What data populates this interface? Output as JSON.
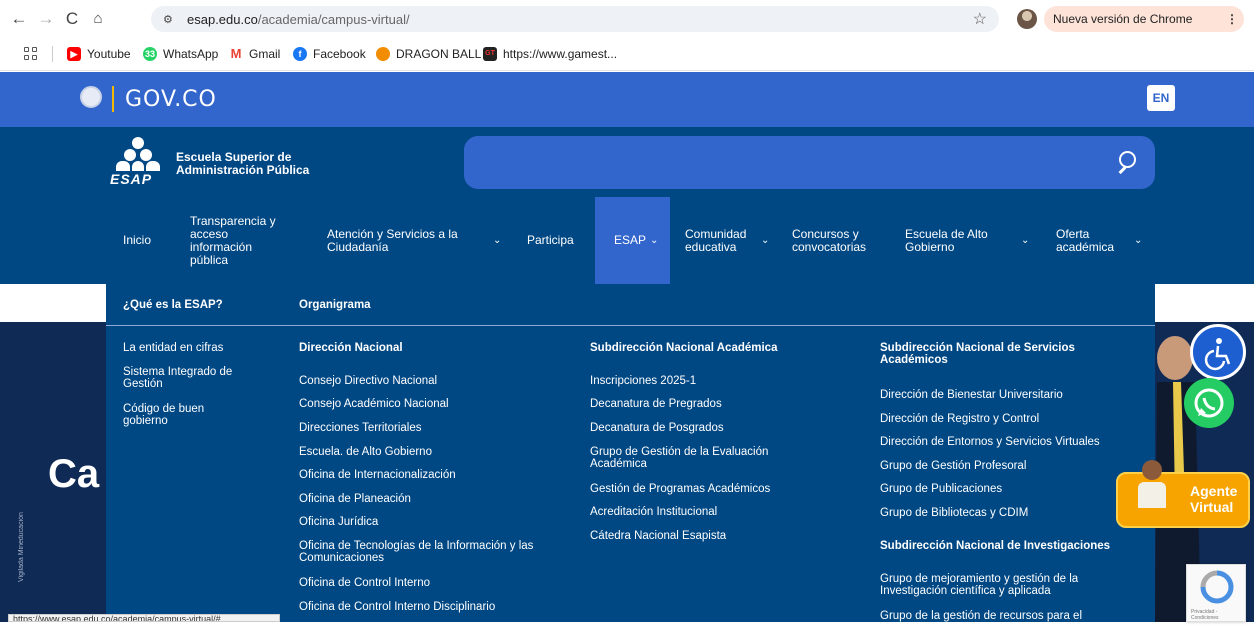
{
  "browser": {
    "url_host": "esap.edu.co",
    "url_path": "/academia/campus-virtual/",
    "update_label": "Nueva versión de Chrome disponible",
    "status_url": "https://www.esap.edu.co/academia/campus-virtual/#"
  },
  "bookmarks": [
    {
      "label": "Youtube",
      "icon": "youtube-icon",
      "color": "#ff0000"
    },
    {
      "label": "WhatsApp",
      "icon": "whatsapp-icon",
      "color": "#25d366"
    },
    {
      "label": "Gmail",
      "icon": "gmail-icon",
      "color": "#ea4335"
    },
    {
      "label": "Facebook",
      "icon": "facebook-icon",
      "color": "#1877f2"
    },
    {
      "label": "DRAGON BALL",
      "icon": "dragon-ball-icon",
      "color": "#f28c00"
    },
    {
      "label": "https://www.gamest...",
      "icon": "gamest-icon",
      "color": "#222222"
    }
  ],
  "gov": {
    "title": "GOV.CO",
    "lang": "EN"
  },
  "esap": {
    "logo_text": "ESAP",
    "name_line1": "Escuela Superior de",
    "name_line2": "Administración Pública"
  },
  "nav": [
    {
      "label": "Inicio"
    },
    {
      "label": "Transparencia y acceso información pública"
    },
    {
      "label": "Atención y Servicios a la Ciudadanía"
    },
    {
      "label": "Participa"
    },
    {
      "label": "ESAP"
    },
    {
      "label": "Comunidad educativa"
    },
    {
      "label": "Concursos y convocatorias"
    },
    {
      "label": "Escuela de Alto Gobierno"
    },
    {
      "label": "Oferta académica"
    }
  ],
  "mega": {
    "top_links": [
      "¿Qué es la ESAP?",
      "Organigrama"
    ],
    "col1": [
      "La entidad en cifras",
      "Sistema Integrado de Gestión",
      "Código de buen gobierno"
    ],
    "col2_head": "Dirección Nacional",
    "col2": [
      "Consejo Directivo Nacional",
      "Consejo Académico Nacional",
      "Direcciones Territoriales",
      "Escuela. de Alto Gobierno",
      "Oficina de Internacionalización",
      "Oficina de Planeación",
      "Oficina Jurídica",
      "Oficina de Tecnologías de la Información y las Comunicaciones",
      "Oficina de Control Interno",
      "Oficina de Control Interno Disciplinario"
    ],
    "col3_head": "Subdirección Nacional Académica",
    "col3": [
      "Inscripciones 2025-1",
      "Decanatura de Pregrados",
      "Decanatura de Posgrados",
      "Grupo de Gestión de la Evaluación Académica",
      "Gestión de Programas Académicos",
      "Acreditación Institucional",
      "Cátedra Nacional Esapista"
    ],
    "col4_head": "Subdirección Nacional de Servicios Académicos",
    "col4": [
      "Dirección de Bienestar Universitario",
      "Dirección de Registro y Control",
      "Dirección de Entornos y Servicios Virtuales",
      "Grupo de Gestión Profesoral",
      "Grupo de Publicaciones",
      "Grupo de Bibliotecas y CDIM"
    ],
    "col4_head2": "Subdirección Nacional de Investigaciones",
    "col4b": [
      "Grupo de mejoramiento y gestión de la Investigación científica y aplicada",
      "Grupo de la gestión de recursos para el"
    ]
  },
  "hero": {
    "partial_title": "Ca",
    "watermark": "Vigilada Mineducación"
  },
  "agent": {
    "line1": "Agente",
    "line2": "Virtual"
  },
  "recaptcha": {
    "footer": "Privacidad - Condiciones"
  }
}
